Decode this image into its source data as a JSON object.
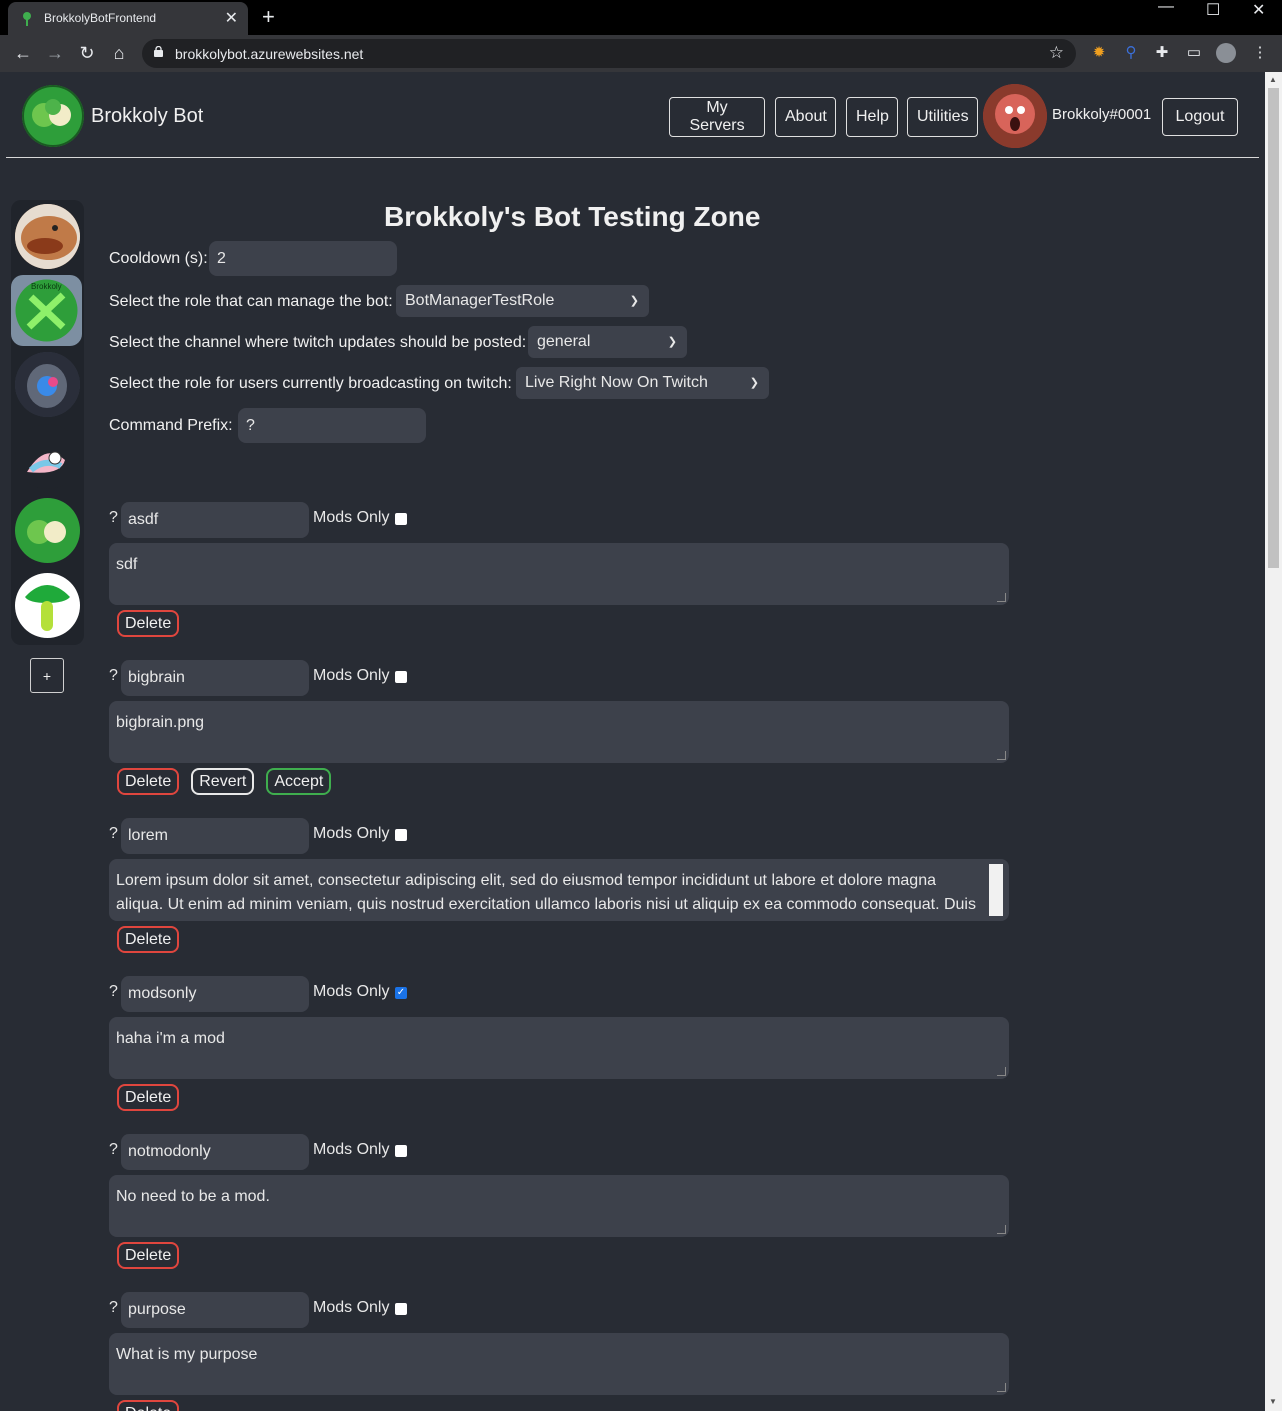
{
  "browser": {
    "tab_title": "BrokkolyBotFrontend",
    "url": "brokkolybot.azurewebsites.net"
  },
  "header": {
    "brand": "Brokkoly Bot",
    "nav": [
      "My Servers",
      "About",
      "Help",
      "Utilities"
    ],
    "username": "Brokkoly#0001",
    "logout": "Logout"
  },
  "sidebar": {
    "add_label": "+"
  },
  "settings": {
    "title": "Brokkoly's Bot Testing Zone",
    "cooldown_label": "Cooldown (s):",
    "cooldown_value": "2",
    "manager_role_label": "Select the role that can manage the bot:",
    "manager_role_value": "BotManagerTestRole",
    "twitch_channel_label": "Select the channel where twitch updates should be posted:",
    "twitch_channel_value": "general",
    "live_role_label": "Select the role for users currently broadcasting on twitch:",
    "live_role_value": "Live Right Now On Twitch",
    "prefix_label": "Command Prefix:",
    "prefix_value": "?"
  },
  "commands": [
    {
      "prefix": "?",
      "name": "asdf",
      "mods_label": "Mods Only",
      "mods_only": false,
      "response": "sdf",
      "delete": "Delete"
    },
    {
      "prefix": "?",
      "name": "bigbrain",
      "mods_label": "Mods Only",
      "mods_only": false,
      "response": "bigbrain.png",
      "delete": "Delete",
      "revert": "Revert",
      "accept": "Accept"
    },
    {
      "prefix": "?",
      "name": "lorem",
      "mods_label": "Mods Only",
      "mods_only": false,
      "response": "Lorem ipsum dolor sit amet, consectetur adipiscing elit, sed do eiusmod tempor incididunt ut labore et dolore magna aliqua. Ut enim ad minim veniam, quis nostrud exercitation ullamco laboris nisi ut aliquip ex ea commodo consequat. Duis",
      "delete": "Delete"
    },
    {
      "prefix": "?",
      "name": "modsonly",
      "mods_label": "Mods Only",
      "mods_only": true,
      "response": "haha i'm a mod",
      "delete": "Delete"
    },
    {
      "prefix": "?",
      "name": "notmodonly",
      "mods_label": "Mods Only",
      "mods_only": false,
      "response": "No need to be a mod.",
      "delete": "Delete"
    },
    {
      "prefix": "?",
      "name": "purpose",
      "mods_label": "Mods Only",
      "mods_only": false,
      "response": "What is my purpose",
      "delete": "Delete"
    }
  ]
}
